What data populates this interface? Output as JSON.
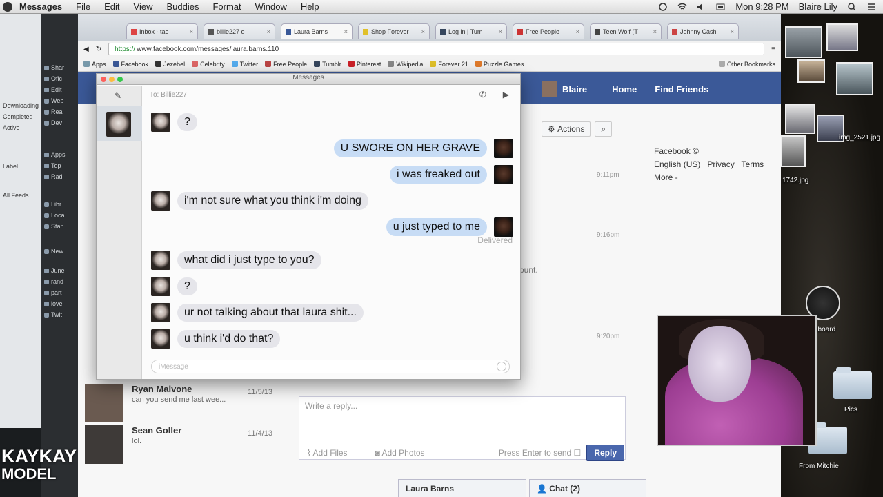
{
  "menubar": {
    "app": "Messages",
    "menus": [
      "File",
      "Edit",
      "View",
      "Buddies",
      "Format",
      "Window",
      "Help"
    ],
    "clock": "Mon 9:28 PM",
    "user": "Blaire Lily"
  },
  "browser": {
    "tabs": [
      "Inbox - tae",
      "billie227 o",
      "Laura Barns",
      "Shop Forever",
      "Log in | Tum",
      "Free People",
      "Teen Wolf (T",
      "Johnny Cash"
    ],
    "url_scheme": "https://",
    "url_rest": "www.facebook.com/messages/laura.barns.110",
    "bookmarks": [
      "Apps",
      "Facebook",
      "Jezebel",
      "Celebrity",
      "Twitter",
      "Free People",
      "Tumblr",
      "Pinterest",
      "Wikipedia",
      "Forever 21",
      "Puzzle Games"
    ],
    "bookmarks_other": "Other Bookmarks"
  },
  "facebook": {
    "profile_name": "Blaire",
    "nav_home": "Home",
    "nav_find_friends": "Find Friends",
    "actions_label": "Actions",
    "footer_title": "Facebook ©",
    "footer_links": [
      "English (US)",
      "Privacy",
      "Terms"
    ],
    "footer_more": "More -",
    "thread_times": [
      "9:11pm",
      "9:16pm",
      "9:20pm"
    ],
    "snippet_fragment": "ount.",
    "conversations": [
      {
        "name": "Ryan Malvone",
        "date": "11/5/13",
        "snippet": "can you send me last wee..."
      },
      {
        "name": "Sean Goller",
        "date": "11/4/13",
        "snippet": "lol."
      }
    ],
    "reply_placeholder": "Write a reply...",
    "add_files": "Add Files",
    "add_photos": "Add Photos",
    "press_enter": "Press Enter to send",
    "reply_button": "Reply",
    "chat_tabs": [
      "Laura Barns",
      "Chat (2)"
    ]
  },
  "messages_window": {
    "title": "Messages",
    "to_label": "To:  Billie227",
    "delivered": "Delivered",
    "input_placeholder": "iMessage",
    "conversation": [
      {
        "from": "them",
        "text": "?"
      },
      {
        "from": "me",
        "text": "U SWORE ON HER GRAVE"
      },
      {
        "from": "me",
        "text": "i was freaked out"
      },
      {
        "from": "them",
        "text": "i'm not sure what you think i'm doing"
      },
      {
        "from": "me",
        "text": "u just typed to me"
      },
      {
        "from": "them",
        "text": "what did i just type to you?"
      },
      {
        "from": "them",
        "text": "?"
      },
      {
        "from": "them",
        "text": "ur not talking about that laura shit..."
      },
      {
        "from": "them",
        "text": "u think i'd do that?"
      }
    ]
  },
  "desktop": {
    "labels": [
      "img_2521.jpg",
      "1742.jpg",
      "Pics",
      "From Mitchie",
      "hboard"
    ]
  },
  "left_strips": {
    "finder": [
      "Downloading",
      "Completed",
      "Active",
      "Label",
      "All Feeds"
    ],
    "itunes": [
      "Shar",
      "Ofic",
      "Edit",
      "Web",
      "Rea",
      "Dev",
      "Apps",
      "Top",
      "Radi",
      "Libr",
      "Loca",
      "Stan",
      "New",
      "June",
      "rand",
      "part",
      "love",
      "Twit"
    ]
  },
  "watermark": {
    "line1": "KAYKAY",
    "line2": "MODEL"
  }
}
